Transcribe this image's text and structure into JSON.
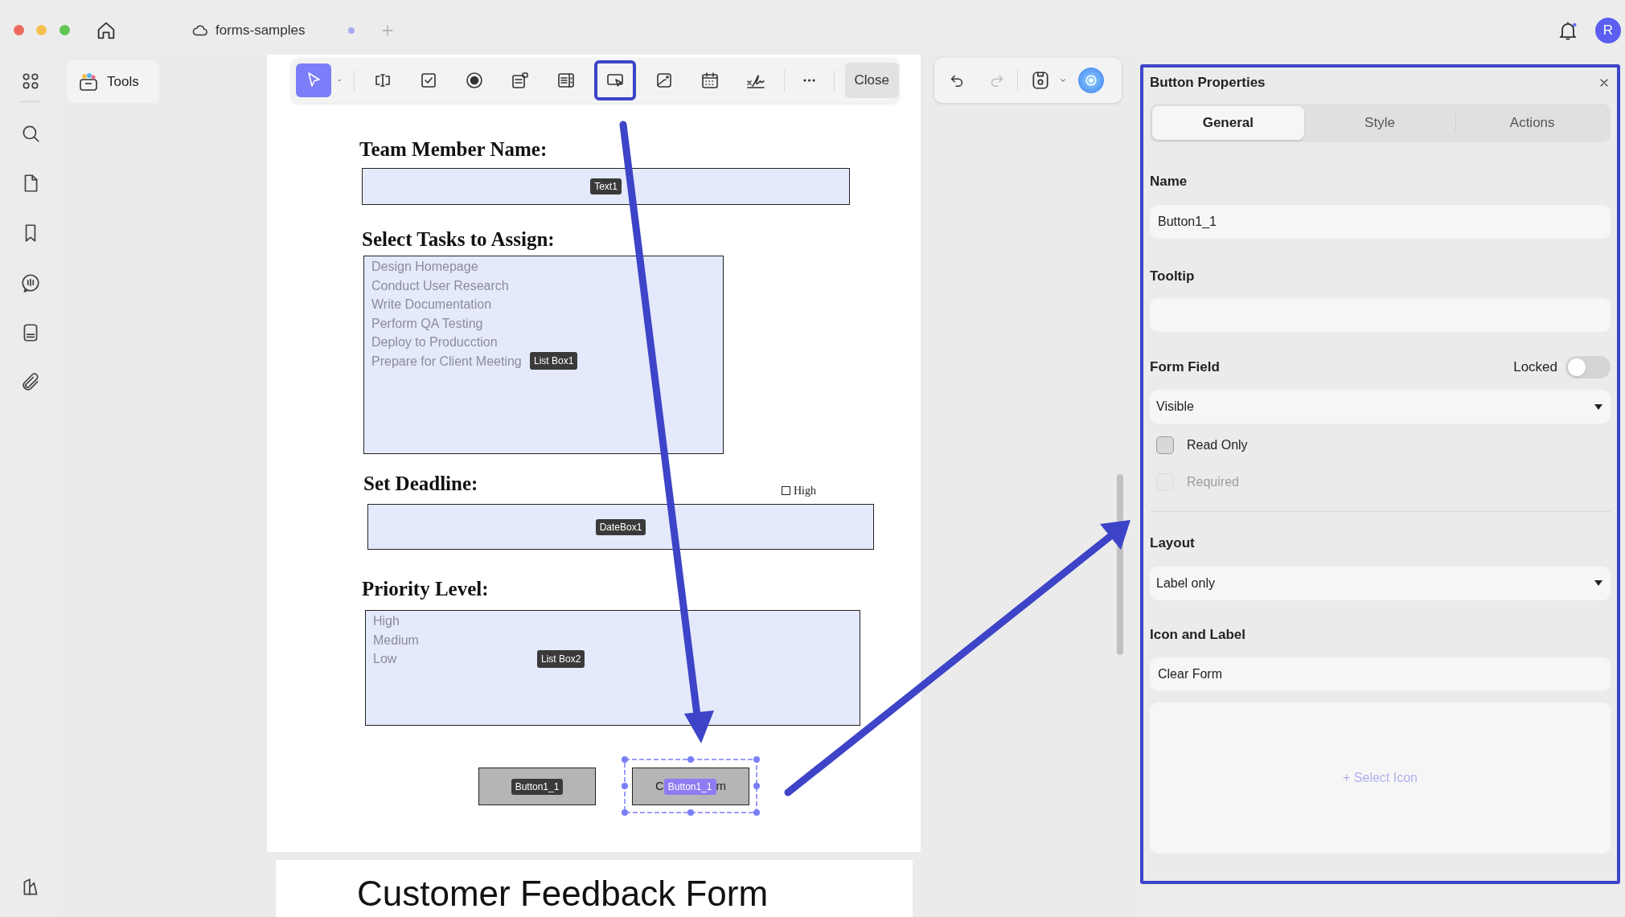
{
  "window": {
    "tab_title": "forms-samples",
    "avatar": "R"
  },
  "sidebar": {
    "tools_label": "Tools"
  },
  "toolbar": {
    "tools": [
      {
        "kind": "pointer",
        "selected": true,
        "annotated": false
      },
      {
        "kind": "text-field",
        "selected": false,
        "annotated": false
      },
      {
        "kind": "checkbox",
        "selected": false,
        "annotated": false
      },
      {
        "kind": "radio",
        "selected": false,
        "annotated": false
      },
      {
        "kind": "combo-box",
        "selected": false,
        "annotated": false
      },
      {
        "kind": "list-box",
        "selected": false,
        "annotated": false
      },
      {
        "kind": "button",
        "selected": false,
        "annotated": true
      },
      {
        "kind": "image",
        "selected": false,
        "annotated": false
      },
      {
        "kind": "calendar",
        "selected": false,
        "annotated": false
      },
      {
        "kind": "signature",
        "selected": false,
        "annotated": false
      }
    ],
    "close": "Close"
  },
  "document": {
    "sections": [
      {
        "heading": "Team Member Name:",
        "field": {
          "kind": "text",
          "tag": "Text1"
        }
      },
      {
        "heading": "Select Tasks to Assign:",
        "field": {
          "kind": "list",
          "tag": "List Box1",
          "options": [
            "Design Homepage",
            "Conduct User Research",
            "Write Documentation",
            "Perform QA Testing",
            "Deploy to Producction",
            "Prepare for Client Meeting"
          ]
        }
      },
      {
        "heading": "Set Deadline:",
        "aside": {
          "label": "High",
          "checked": false
        },
        "field": {
          "kind": "date",
          "tag": "DateBox1"
        }
      },
      {
        "heading": "Priority Level:",
        "field": {
          "kind": "list",
          "tag": "List Box2",
          "options": [
            "High",
            "Medium",
            "Low"
          ]
        }
      }
    ],
    "buttons": [
      {
        "tag": "Button1_1",
        "selected": false
      },
      {
        "tag": "Button1_1",
        "selected": true,
        "label_start": "C",
        "label_end": "m"
      }
    ],
    "next_page_title": "Customer Feedback Form"
  },
  "panel": {
    "title": "Button Properties",
    "tabs": [
      {
        "label": "General",
        "selected": true
      },
      {
        "label": "Style",
        "selected": false
      },
      {
        "label": "Actions",
        "selected": false
      }
    ],
    "name": {
      "label": "Name",
      "value": "Button1_1"
    },
    "tooltip": {
      "label": "Tooltip"
    },
    "form_field": {
      "label": "Form Field",
      "locked": {
        "label": "Locked",
        "on": false
      },
      "visibility": "Visible",
      "options": [
        {
          "label": "Read Only",
          "checked": false,
          "disabled": false
        },
        {
          "label": "Required",
          "checked": false,
          "disabled": true
        }
      ]
    },
    "layout": {
      "label": "Layout",
      "value": "Label only"
    },
    "icon_and_label": {
      "label": "Icon and Label",
      "value": "Clear Form",
      "select_icon": "+ Select Icon"
    }
  }
}
